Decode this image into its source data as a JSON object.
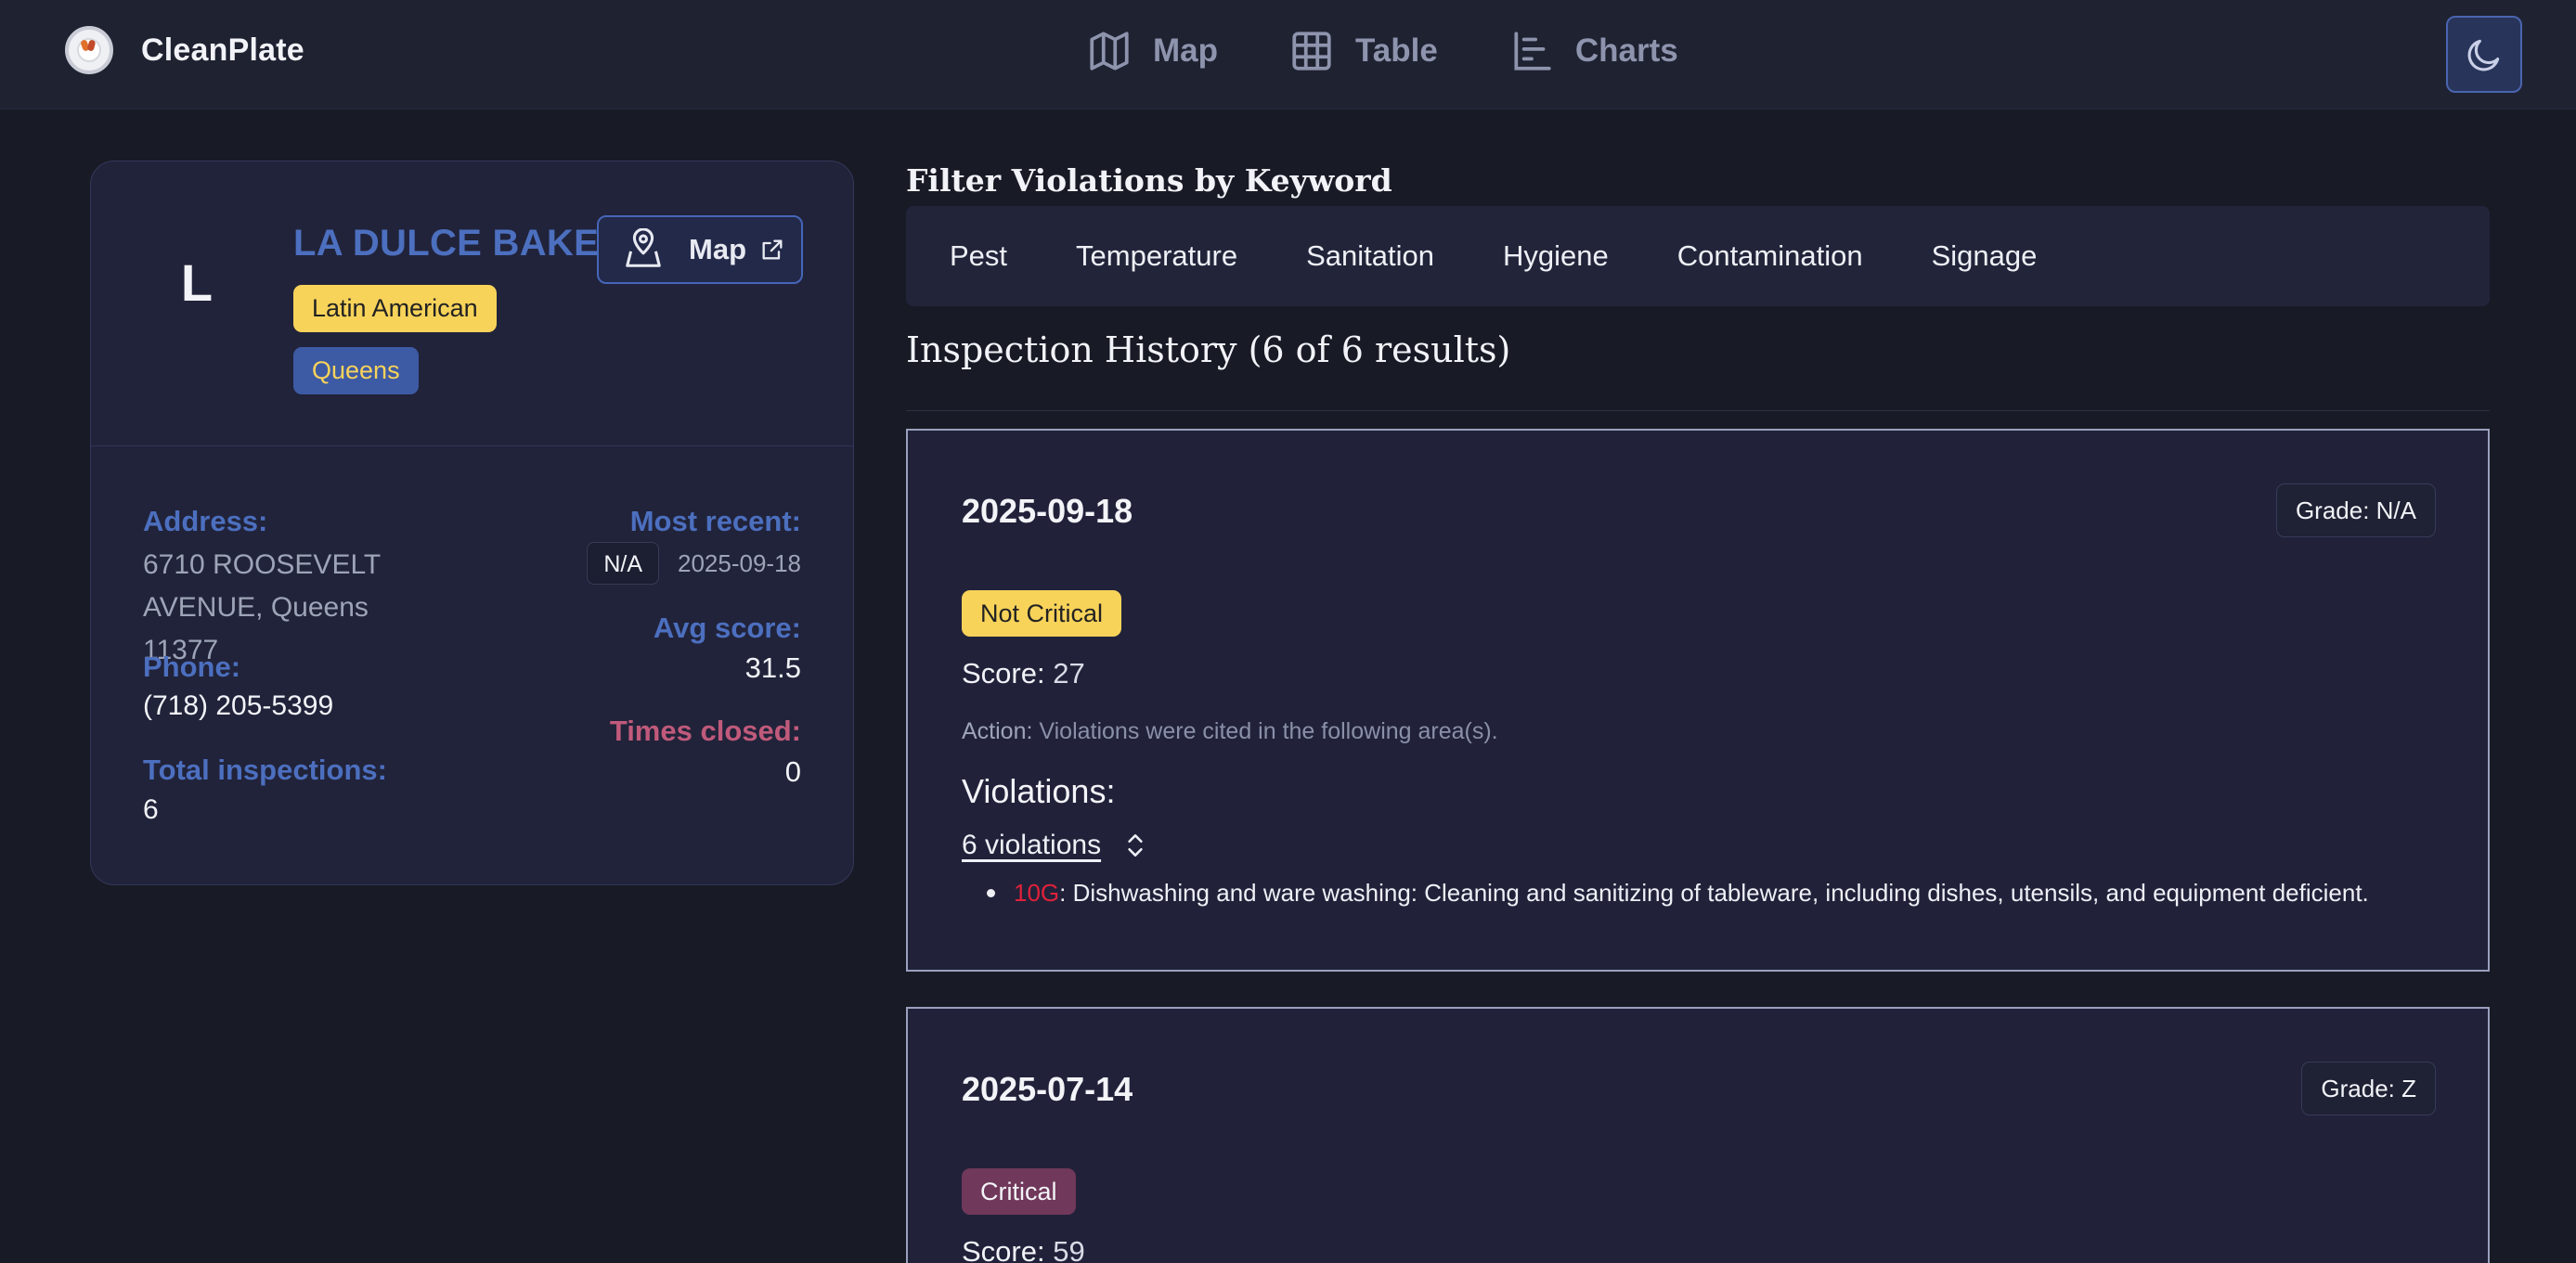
{
  "app": {
    "name": "CleanPlate"
  },
  "nav": {
    "items": [
      {
        "label": "Map",
        "icon": "map-icon"
      },
      {
        "label": "Table",
        "icon": "table-icon"
      },
      {
        "label": "Charts",
        "icon": "chart-icon"
      }
    ],
    "theme_icon": "moon-icon"
  },
  "restaurant": {
    "initial": "L",
    "name": "LA DULCE BAKERY",
    "cuisine": "Latin American",
    "borough": "Queens",
    "map_label": "Map",
    "address_label": "Address:",
    "address": "6710 ROOSEVELT AVENUE, Queens 11377",
    "phone_label": "Phone:",
    "phone": "(718) 205-5399",
    "total_label": "Total inspections:",
    "total": "6",
    "recent_label": "Most recent:",
    "recent_grade": "N/A",
    "recent_date": "2025-09-18",
    "avg_label": "Avg score:",
    "avg": "31.5",
    "closed_label": "Times closed:",
    "closed": "0"
  },
  "filter": {
    "title": "Filter Violations by Keyword",
    "chips": [
      "Pest",
      "Temperature",
      "Sanitation",
      "Hygiene",
      "Contamination",
      "Signage"
    ]
  },
  "history": {
    "title": "Inspection History (6 of 6 results)",
    "inspections": [
      {
        "date": "2025-09-18",
        "grade": "Grade: N/A",
        "critical": "Not Critical",
        "score_label": "Score:",
        "score": "27",
        "action_label": "Action:",
        "action": "Violations were cited in the following area(s).",
        "violations_title": "Violations:",
        "violations_count": "6 violations",
        "violation_code": "10G",
        "violation_text": ": Dishwashing and ware washing: Cleaning and sanitizing of tableware, including dishes, utensils, and equipment deficient."
      },
      {
        "date": "2025-07-14",
        "grade": "Grade: Z",
        "critical": "Critical",
        "score_label": "Score:",
        "score": "59"
      }
    ]
  },
  "colors": {
    "accent": "#4c6fbf",
    "yellow": "#f8d35a",
    "critical": "#70385a",
    "closed": "#c05a7b",
    "code": "#e0213a"
  }
}
